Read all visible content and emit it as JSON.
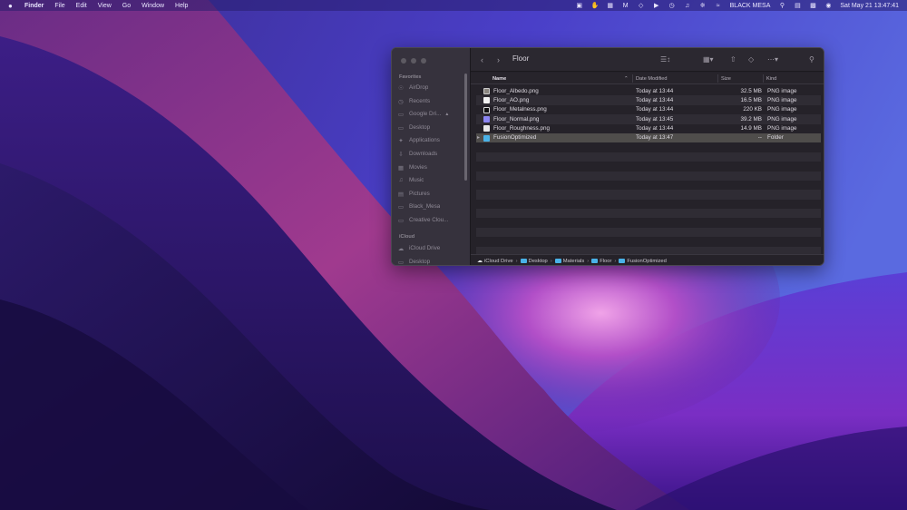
{
  "menubar": {
    "app_name": "Finder",
    "menus": [
      "File",
      "Edit",
      "View",
      "Go",
      "Window",
      "Help"
    ],
    "status_label": "BLACK MESA",
    "datetime": "Sat May 21  13:47:41",
    "status_icons": [
      "teams-icon",
      "hand-icon",
      "square-app-icon",
      "malwarebytes-icon",
      "dropbox-icon",
      "play-icon",
      "clock-icon",
      "volume-icon",
      "bluetooth-icon",
      "wifi-icon"
    ],
    "right_icons": [
      "search-icon",
      "control-center-icon",
      "notification-icon",
      "siri-icon"
    ]
  },
  "finder": {
    "folder_title": "Floor",
    "sidebar": {
      "favorites_header": "Favorites",
      "favorites": [
        {
          "label": "AirDrop",
          "icon": "airdrop-icon"
        },
        {
          "label": "Recents",
          "icon": "clock-icon"
        },
        {
          "label": "Google Dri...",
          "icon": "drive-icon"
        },
        {
          "label": "Desktop",
          "icon": "desktop-icon"
        },
        {
          "label": "Applications",
          "icon": "applications-icon"
        },
        {
          "label": "Downloads",
          "icon": "downloads-icon"
        },
        {
          "label": "Movies",
          "icon": "movies-icon"
        },
        {
          "label": "Music",
          "icon": "music-icon"
        },
        {
          "label": "Pictures",
          "icon": "pictures-icon"
        },
        {
          "label": "Black_Mesa",
          "icon": "folder-icon"
        },
        {
          "label": "Creative Clou...",
          "icon": "folder-icon"
        }
      ],
      "icloud_header": "iCloud",
      "icloud": [
        {
          "label": "iCloud Drive",
          "icon": "cloud-icon"
        },
        {
          "label": "Desktop",
          "icon": "desktop-icon"
        }
      ]
    },
    "columns": {
      "name": "Name",
      "date": "Date Modified",
      "size": "Size",
      "kind": "Kind"
    },
    "files": [
      {
        "name": "Floor_Albedo.png",
        "date": "Today at 13:44",
        "size": "32.5 MB",
        "kind": "PNG image",
        "thumb": "#8a8680"
      },
      {
        "name": "Floor_AO.png",
        "date": "Today at 13:44",
        "size": "16.5 MB",
        "kind": "PNG image",
        "thumb": "#f2f2f2"
      },
      {
        "name": "Floor_Metalness.png",
        "date": "Today at 13:44",
        "size": "220 KB",
        "kind": "PNG image",
        "thumb": "#111111"
      },
      {
        "name": "Floor_Normal.png",
        "date": "Today at 13:45",
        "size": "39.2 MB",
        "kind": "PNG image",
        "thumb": "#8c86f2"
      },
      {
        "name": "Floor_Roughness.png",
        "date": "Today at 13:44",
        "size": "14.9 MB",
        "kind": "PNG image",
        "thumb": "#e8e8e8"
      },
      {
        "name": "FusionOptimized",
        "date": "Today at 13:47",
        "size": "--",
        "kind": "Folder",
        "thumb": "#4ab2e8"
      }
    ],
    "path": [
      "iCloud Drive",
      "Desktop",
      "Materials",
      "Floor",
      "FusionOptimized"
    ]
  }
}
